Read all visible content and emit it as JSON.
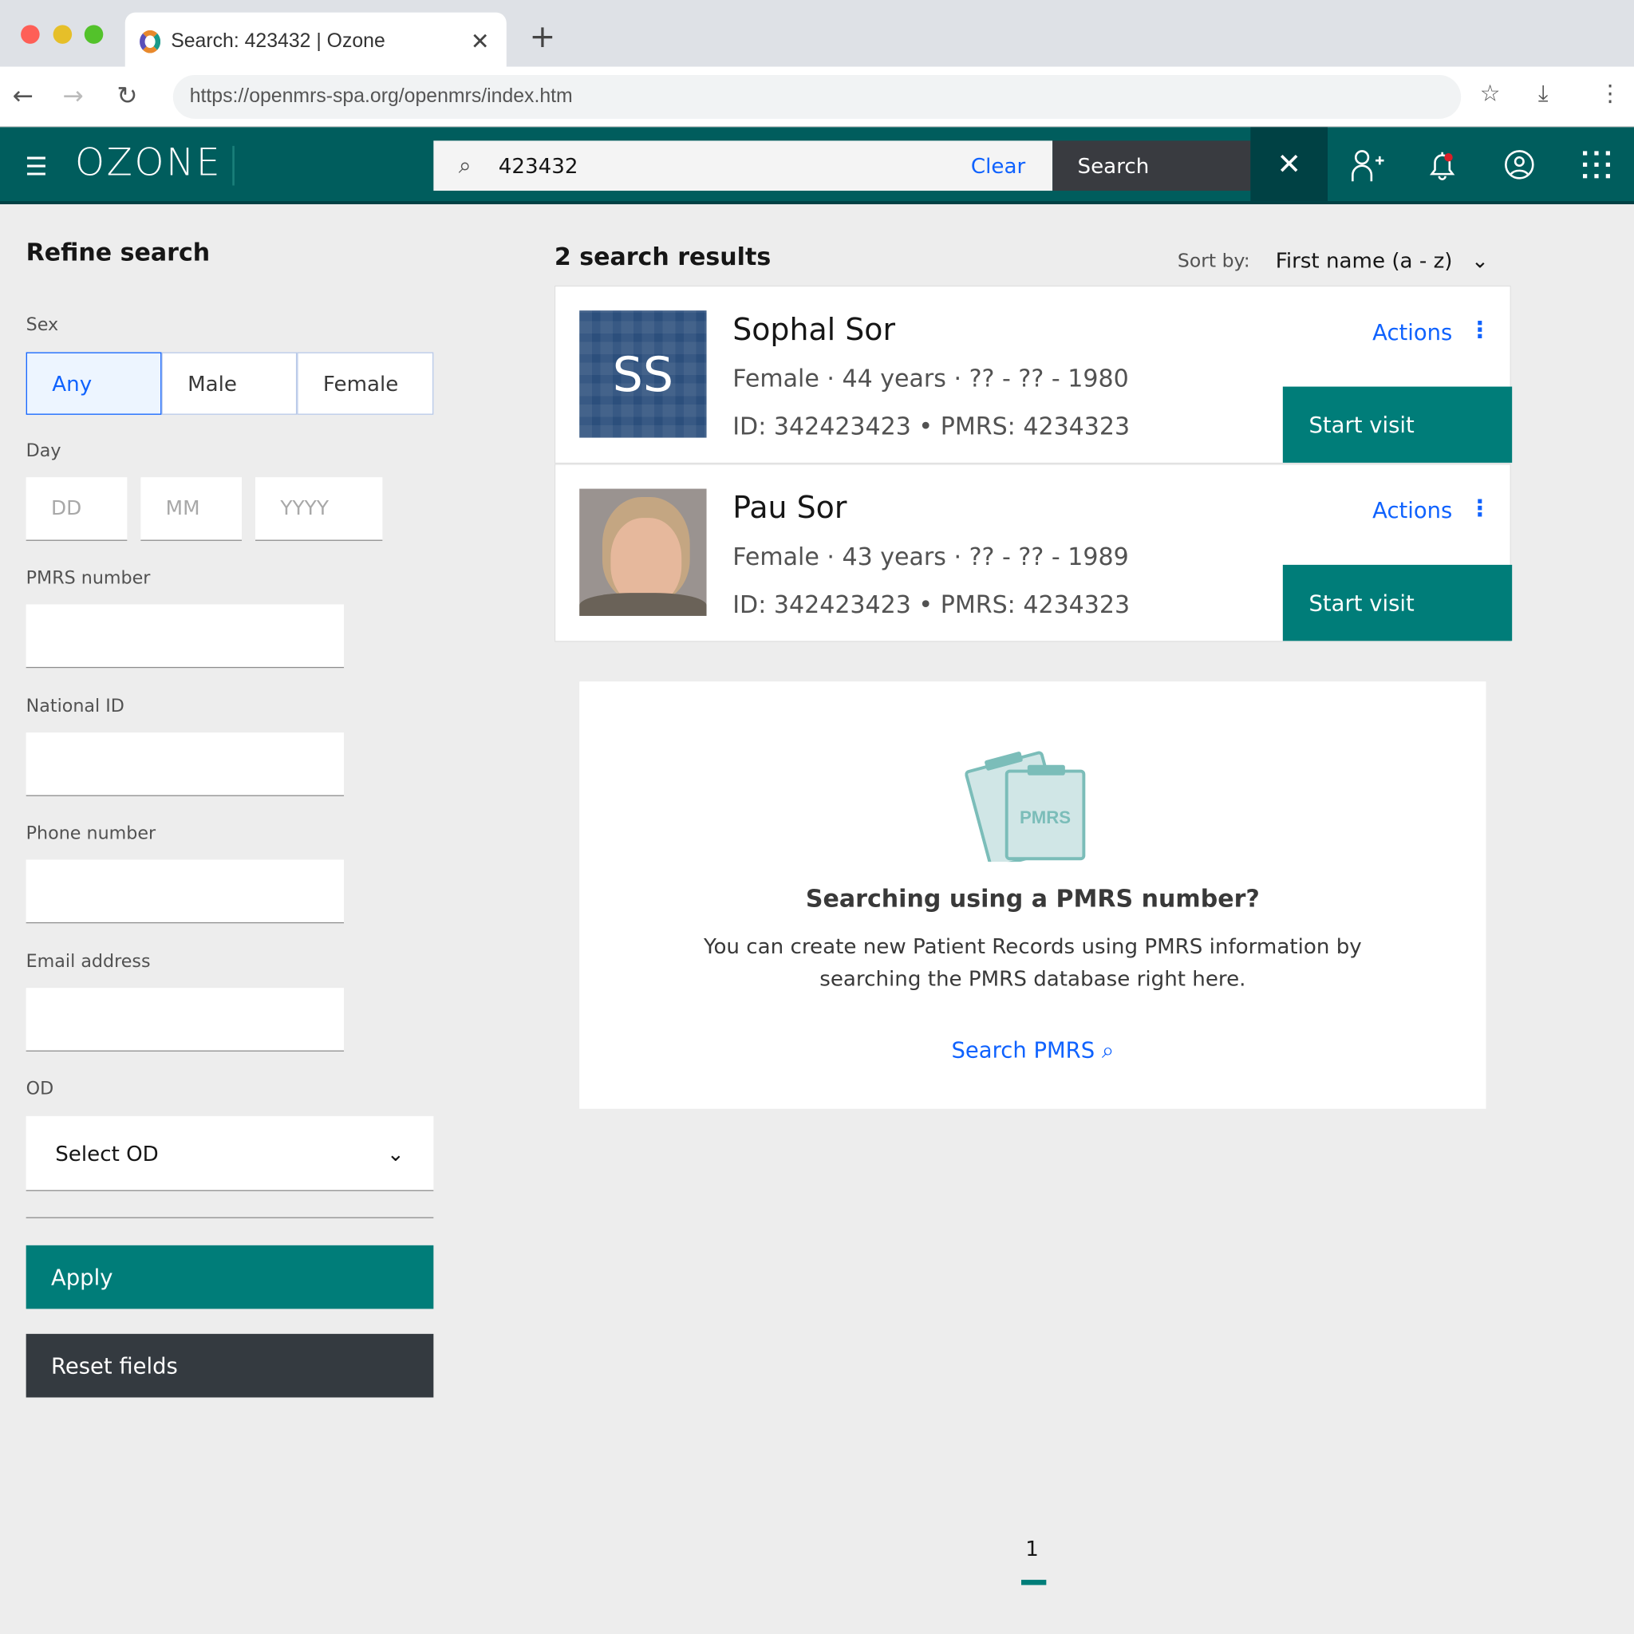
{
  "browser": {
    "tab_title": "Search: 423432 | Ozone",
    "url": "https://openmrs-spa.org/openmrs/index.htm"
  },
  "header": {
    "logo": "OZONE",
    "search_value": "423432",
    "clear_label": "Clear",
    "search_label": "Search"
  },
  "refine": {
    "title": "Refine search",
    "sex_label": "Sex",
    "sex_options": [
      "Any",
      "Male",
      "Female"
    ],
    "sex_selected": "Any",
    "day_label": "Day",
    "day_placeholders": [
      "DD",
      "MM",
      "YYYY"
    ],
    "pmrs_label": "PMRS number",
    "national_label": "National ID",
    "phone_label": "Phone number",
    "email_label": "Email address",
    "od_label": "OD",
    "od_value": "Select OD",
    "apply": "Apply",
    "reset": "Reset fields"
  },
  "results": {
    "count_label": "2 search results",
    "sort_label": "Sort by:",
    "sort_value": "First name (a - z)",
    "patients": [
      {
        "initials": "SS",
        "name": "Sophal Sor",
        "sex": "Female",
        "age": "44 years",
        "dob": "?? - ?? - 1980",
        "ids": "ID: 342423423 • PMRS: 4234323",
        "actions": "Actions",
        "start": "Start visit"
      },
      {
        "initials": "",
        "name": "Pau Sor",
        "sex": "Female",
        "age": "43 years",
        "dob": "?? - ?? - 1989",
        "ids": "ID: 342423423 • PMRS: 4234323",
        "actions": "Actions",
        "start": "Start visit"
      }
    ]
  },
  "empty": {
    "illustration_text": "PMRS",
    "title": "Searching using a PMRS number?",
    "line1": "You can create new Patient Records using PMRS information by",
    "line2": "searching the PMRS database right here.",
    "link": "Search PMRS"
  },
  "pagination": {
    "current": "1"
  },
  "colors": {
    "header": "#005d5d",
    "primary": "#007d79",
    "link": "#0f62fe",
    "notification": "#da1e28"
  }
}
